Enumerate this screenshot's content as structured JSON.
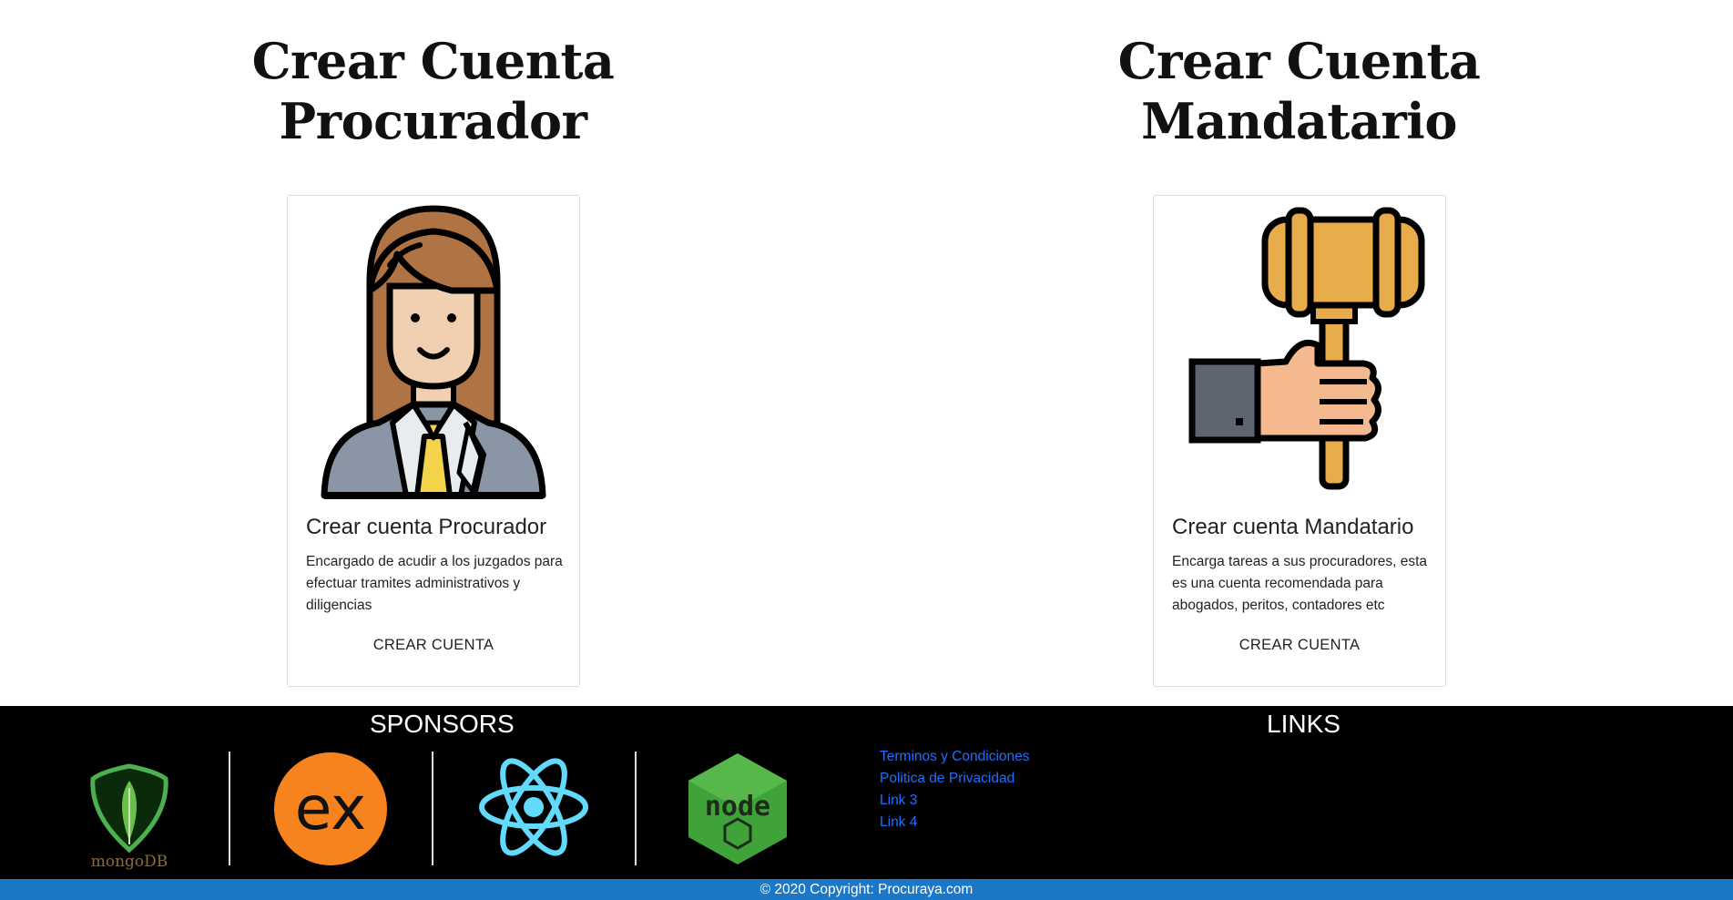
{
  "procurador": {
    "heading_line1": "Crear Cuenta",
    "heading_line2": "Procurador",
    "card_title": "Crear cuenta Procurador",
    "card_text": "Encargado de acudir a los juzgados para efectuar tramites administrativos y diligencias",
    "button_label": "CREAR CUENTA",
    "icon": "woman-lawyer-icon"
  },
  "mandatario": {
    "heading_line1": "Crear Cuenta",
    "heading_line2": "Mandatario",
    "card_title": "Crear cuenta Mandatario",
    "card_text": "Encarga tareas a sus procuradores, esta es una cuenta recomendada para abogados, peritos, contadores etc",
    "button_label": "CREAR CUENTA",
    "icon": "gavel-hand-icon"
  },
  "footer": {
    "sponsors_title": "SPONSORS",
    "links_title": "LINKS",
    "sponsor_logos": [
      "mongodb-logo",
      "express-logo",
      "react-logo",
      "nodejs-logo"
    ],
    "mongodb_text": "mongoDB",
    "express_text": "ex",
    "node_text": "node",
    "links": [
      "Terminos y Condiciones",
      "Politica de Privacidad",
      "Link 3",
      "Link 4"
    ],
    "copyright": "© 2020 Copyright: Procuraya.com"
  },
  "colors": {
    "footer_bg": "#000000",
    "copyright_bg": "#1b77c8",
    "link": "#1e6fff",
    "gavel": "#e8ac4a",
    "hair": "#b07444",
    "skin": "#f0d0b0",
    "suit": "#8a96a6"
  }
}
